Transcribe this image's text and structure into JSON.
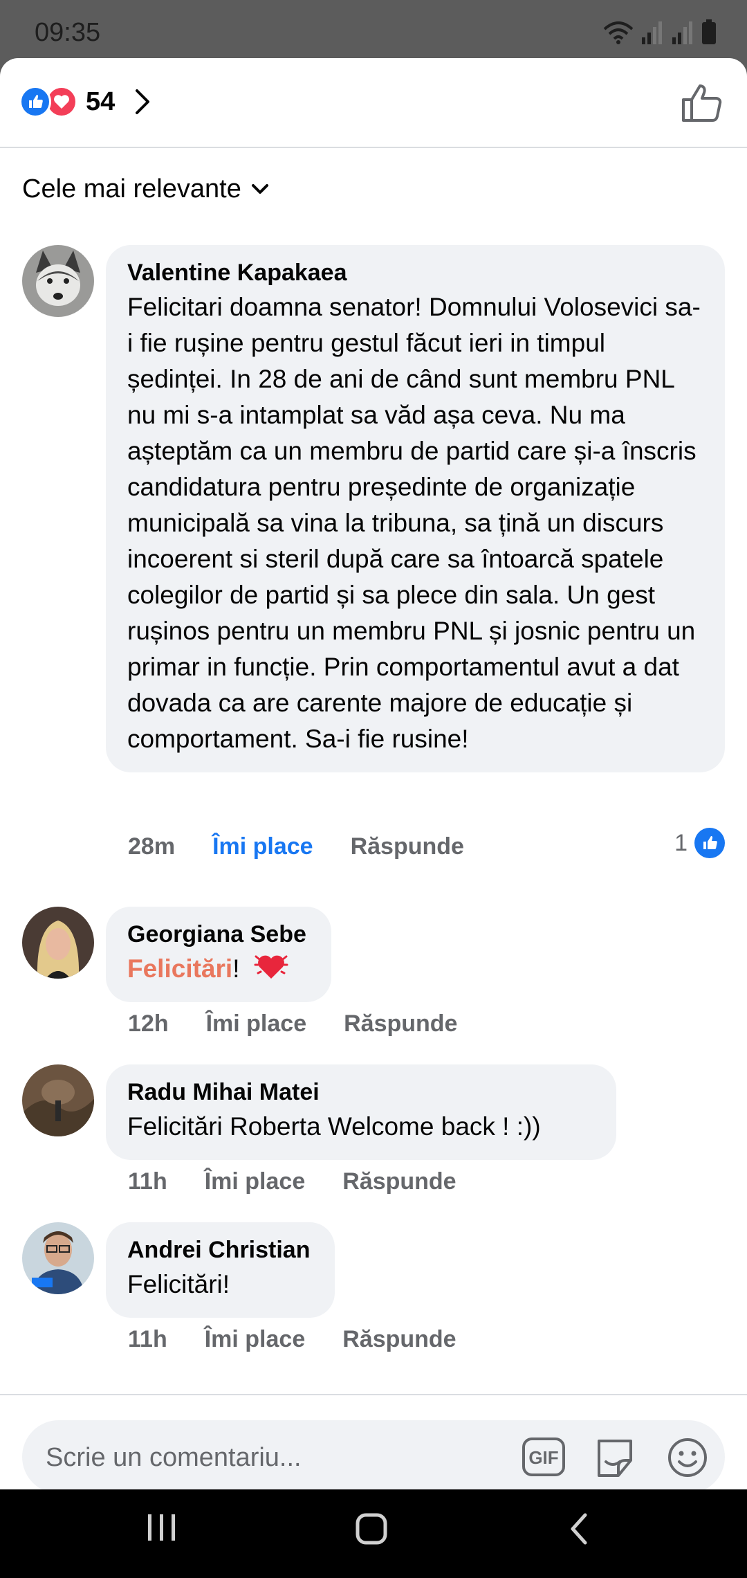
{
  "status_bar": {
    "time": "09:35"
  },
  "header": {
    "reaction_count": "54",
    "reaction_icons": [
      "like-icon",
      "love-icon"
    ]
  },
  "sort": {
    "label": "Cele mai relevante"
  },
  "comments": [
    {
      "author": "Valentine Kapakaea",
      "text": "Felicitari doamna senator! Domnului Volosevici sa-i fie rușine pentru gestul făcut ieri in timpul ședinței. In 28 de ani de când sunt membru PNL nu mi s-a intamplat sa văd așa ceva. Nu ma așteptăm ca un membru de partid care și-a înscris candidatura pentru președinte de organizație municipală sa vina la tribuna, sa țină un discurs incoerent si steril după care sa întoarcă spatele colegilor de partid și sa plece din sala. Un gest rușinos pentru un membru PNL și josnic pentru un primar in funcție. Prin comportamentul avut a dat dovada ca are carente majore de educație și comportament. Sa-i fie rusine!",
      "time": "28m",
      "like_label": "Îmi place",
      "reply_label": "Răspunde",
      "likes": "1"
    },
    {
      "author": "Georgiana Sebe",
      "text_highlight": "Felicitări",
      "text_rest": "!",
      "time": "12h",
      "like_label": "Îmi place",
      "reply_label": "Răspunde"
    },
    {
      "author": "Radu Mihai Matei",
      "text": "Felicitări Roberta Welcome back ! :))",
      "time": "11h",
      "like_label": "Îmi place",
      "reply_label": "Răspunde"
    },
    {
      "author": "Andrei Christian",
      "text": "Felicitări!",
      "time": "11h",
      "like_label": "Îmi place",
      "reply_label": "Răspunde"
    }
  ],
  "composer": {
    "placeholder": "Scrie un comentariu...",
    "gif_label": "GIF"
  },
  "colors": {
    "accent": "#1877f2",
    "love": "#f33e58",
    "highlight_text": "#e9775d",
    "bubble": "#f0f2f5"
  }
}
